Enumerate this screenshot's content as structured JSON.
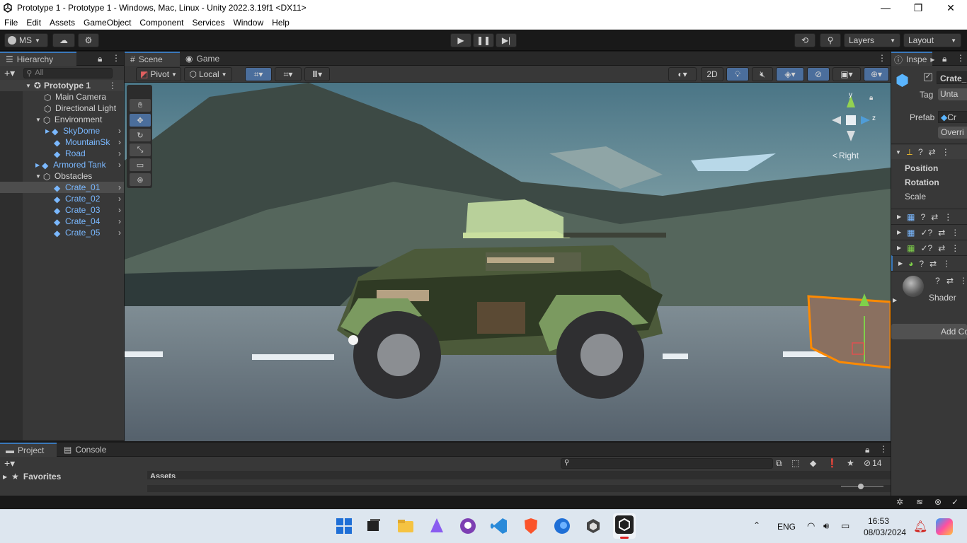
{
  "window": {
    "title": "Prototype 1 - Prototype 1 - Windows, Mac, Linux - Unity 2022.3.19f1 <DX11>",
    "minimize": "—",
    "restore": "❐",
    "close": "✕"
  },
  "menu": [
    "File",
    "Edit",
    "Assets",
    "GameObject",
    "Component",
    "Services",
    "Window",
    "Help"
  ],
  "toolbar": {
    "account_label": "MS",
    "layers_label": "Layers",
    "layout_label": "Layout"
  },
  "hierarchy": {
    "tab": "Hierarchy",
    "search_placeholder": "All",
    "scene": "Prototype 1",
    "items": [
      {
        "label": "Main Camera",
        "prefab": false
      },
      {
        "label": "Directional Light",
        "prefab": false
      },
      {
        "label": "Environment",
        "prefab": false
      },
      {
        "label": "SkyDome",
        "prefab": true
      },
      {
        "label": "MountainSk",
        "prefab": true
      },
      {
        "label": "Road",
        "prefab": true
      },
      {
        "label": "Armored Tank",
        "prefab": true
      },
      {
        "label": "Obstacles",
        "prefab": false
      },
      {
        "label": "Crate_01",
        "prefab": true
      },
      {
        "label": "Crate_02",
        "prefab": true
      },
      {
        "label": "Crate_03",
        "prefab": true
      },
      {
        "label": "Crate_04",
        "prefab": true
      },
      {
        "label": "Crate_05",
        "prefab": true
      }
    ]
  },
  "scene": {
    "tab_scene": "Scene",
    "tab_game": "Game",
    "pivot": "Pivot",
    "local": "Local",
    "twod": "2D",
    "gizmo_view": "Right",
    "gizmo_y": "y",
    "gizmo_z": "z"
  },
  "inspector": {
    "tab": "Inspe",
    "object_name": "Crate_",
    "tag_label": "Tag",
    "tag_value": "Unta",
    "prefab_label": "Prefab",
    "prefab_value": "Cr",
    "overrides": "Overri",
    "position": "Position",
    "rotation": "Rotation",
    "scale": "Scale",
    "shader": "Shader",
    "add_component": "Add Co"
  },
  "project": {
    "tab_project": "Project",
    "tab_console": "Console",
    "favorites": "Favorites",
    "assets": "Assets",
    "hidden_count": "14"
  },
  "taskbar": {
    "lang": "ENG",
    "time": "16:53",
    "date": "08/03/2024"
  },
  "colors": {
    "accent": "#3a79bb",
    "prefab_blue": "#7ab8ff"
  }
}
